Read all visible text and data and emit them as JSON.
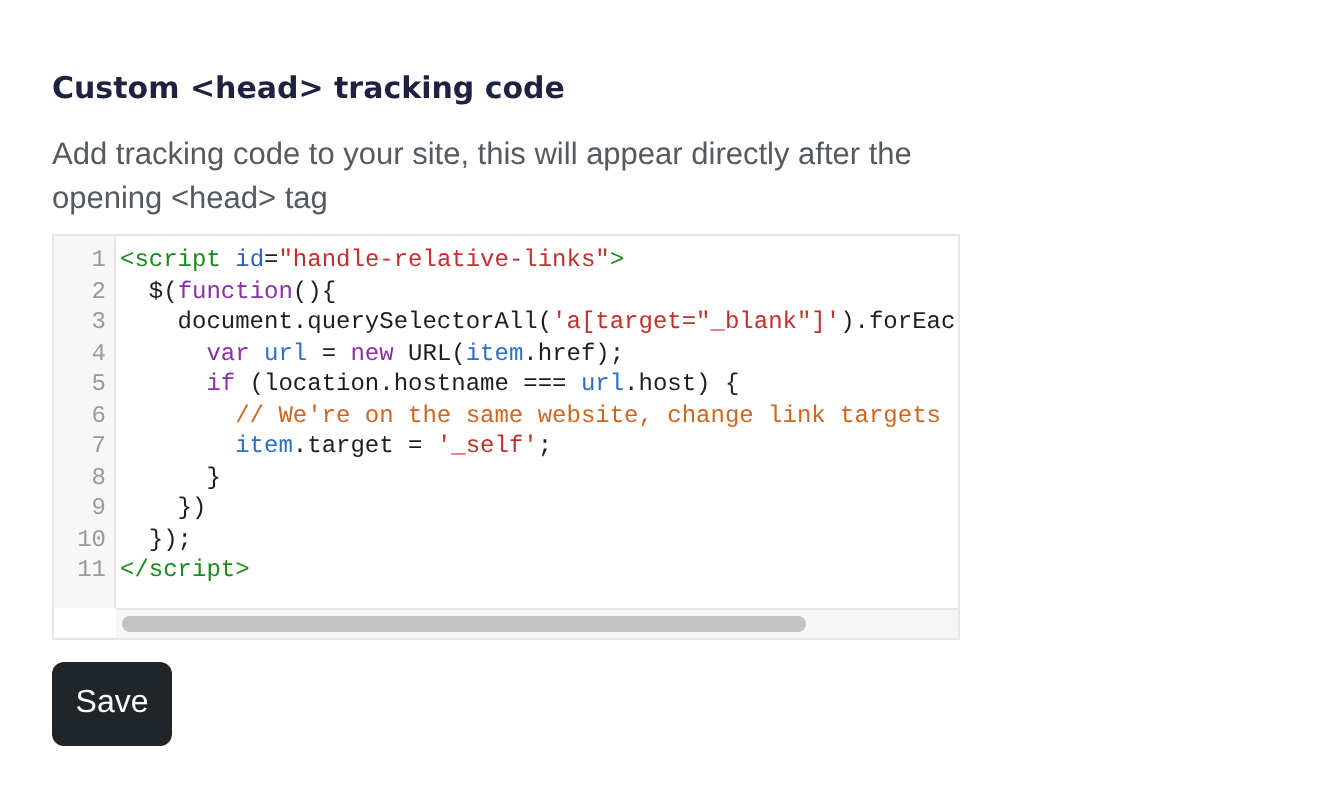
{
  "title": "Custom <head> tracking code",
  "description": "Add tracking code to your site, this will appear directly after the opening <head> tag",
  "editor": {
    "lines": [
      {
        "number": "1",
        "tokens": [
          {
            "t": "<script",
            "kind": "tag"
          },
          {
            "t": " id",
            "kind": "attr"
          },
          {
            "t": "=",
            "kind": "plain"
          },
          {
            "t": "\"handle-relative-links\"",
            "kind": "string"
          },
          {
            "t": ">",
            "kind": "tag"
          }
        ]
      },
      {
        "number": "2",
        "tokens": [
          {
            "t": "  $(",
            "kind": "plain"
          },
          {
            "t": "function",
            "kind": "keyword"
          },
          {
            "t": "(){",
            "kind": "plain"
          }
        ]
      },
      {
        "number": "3",
        "tokens": [
          {
            "t": "    document.querySelectorAll(",
            "kind": "plain"
          },
          {
            "t": "'a[target=\"_blank\"]'",
            "kind": "string"
          },
          {
            "t": ").forEac",
            "kind": "plain"
          }
        ]
      },
      {
        "number": "4",
        "tokens": [
          {
            "t": "      var",
            "kind": "keyword"
          },
          {
            "t": " url",
            "kind": "variable"
          },
          {
            "t": " = ",
            "kind": "plain"
          },
          {
            "t": "new",
            "kind": "keyword"
          },
          {
            "t": " URL(",
            "kind": "plain"
          },
          {
            "t": "item",
            "kind": "variable"
          },
          {
            "t": ".href);",
            "kind": "plain"
          }
        ]
      },
      {
        "number": "5",
        "tokens": [
          {
            "t": "      if",
            "kind": "keyword"
          },
          {
            "t": " (location.hostname === ",
            "kind": "plain"
          },
          {
            "t": "url",
            "kind": "variable"
          },
          {
            "t": ".host) {",
            "kind": "plain"
          }
        ]
      },
      {
        "number": "6",
        "tokens": [
          {
            "t": "        // We're on the same website, change link targets",
            "kind": "comment"
          }
        ]
      },
      {
        "number": "7",
        "tokens": [
          {
            "t": "        item",
            "kind": "variable"
          },
          {
            "t": ".target = ",
            "kind": "plain"
          },
          {
            "t": "'_self'",
            "kind": "string"
          },
          {
            "t": ";",
            "kind": "plain"
          }
        ]
      },
      {
        "number": "8",
        "tokens": [
          {
            "t": "      }",
            "kind": "plain"
          }
        ]
      },
      {
        "number": "9",
        "tokens": [
          {
            "t": "    })",
            "kind": "plain"
          }
        ]
      },
      {
        "number": "10",
        "tokens": [
          {
            "t": "  });",
            "kind": "plain"
          }
        ]
      },
      {
        "number": "11",
        "tokens": [
          {
            "t": "</script>",
            "kind": "tag"
          }
        ]
      }
    ]
  },
  "save_button": "Save"
}
